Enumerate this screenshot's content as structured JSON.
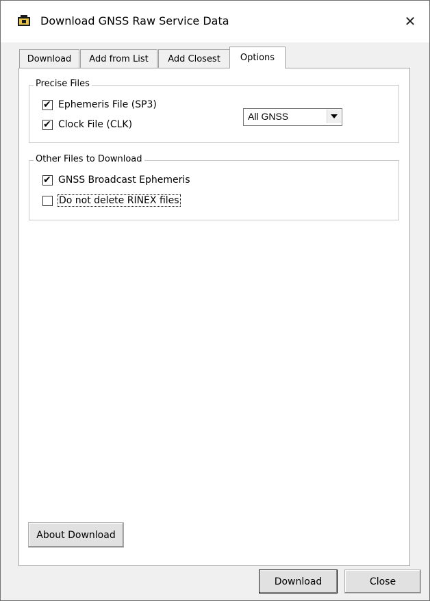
{
  "window": {
    "title": "Download GNSS Raw Service Data",
    "close_glyph": "✕"
  },
  "tabs": [
    {
      "label": "Download",
      "active": false
    },
    {
      "label": "Add from List",
      "active": false
    },
    {
      "label": "Add Closest",
      "active": false
    },
    {
      "label": "Options",
      "active": true
    }
  ],
  "precise_files": {
    "legend": "Precise Files",
    "ephemeris": {
      "label": "Ephemeris File (SP3)",
      "checked": true
    },
    "clock": {
      "label": "Clock File (CLK)",
      "checked": true
    },
    "constellation": {
      "selected": "All GNSS"
    }
  },
  "other_files": {
    "legend": "Other Files to Download",
    "broadcast": {
      "label": "GNSS Broadcast Ephemeris",
      "checked": true
    },
    "keep_rinex": {
      "label": "Do not delete RINEX files",
      "checked": false
    }
  },
  "buttons": {
    "about": "About Download",
    "download": "Download",
    "close": "Close"
  },
  "icons": {
    "app": "gnss-download-icon",
    "dropdown": "chevron-down-icon",
    "check": "✔"
  }
}
